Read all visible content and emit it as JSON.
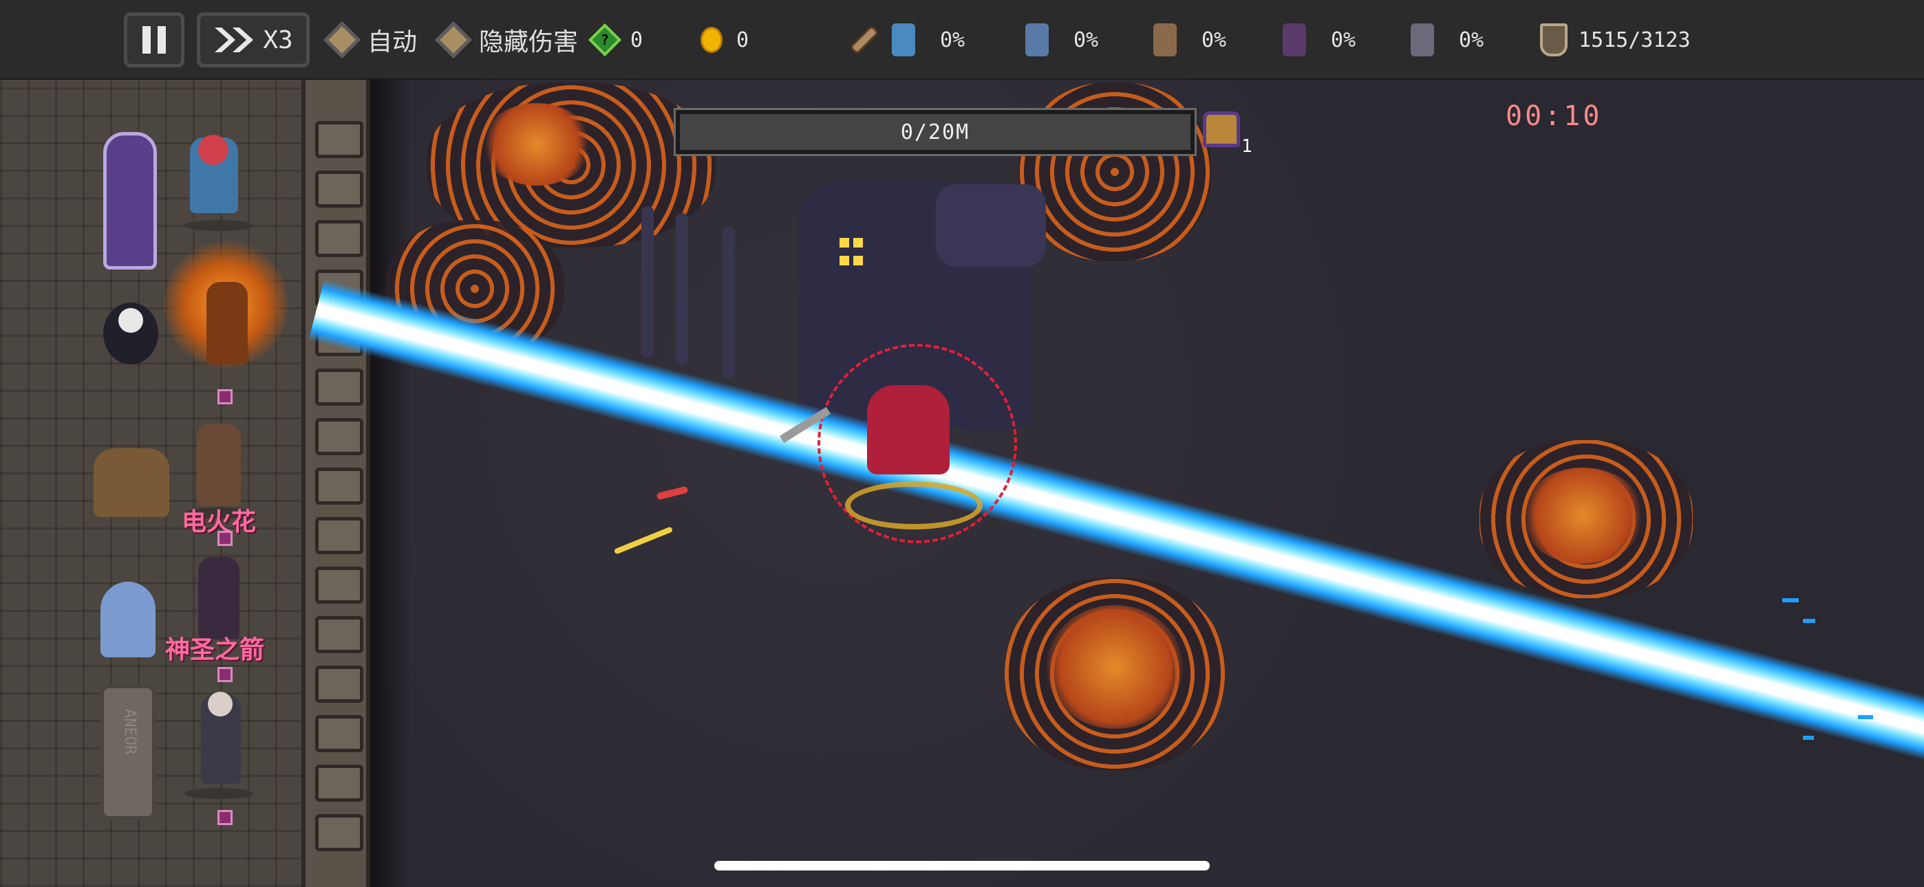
{
  "topbar": {
    "speed_label": "X3",
    "auto_label": "自动",
    "hide_damage_label": "隐藏伤害",
    "gems": "0",
    "gem_symbol": "?",
    "coins": "0",
    "hero_stats": [
      {
        "name": "dwarf-warrior",
        "pct": "0%",
        "color": "#4a8ac0"
      },
      {
        "name": "frost-spirit",
        "pct": "0%",
        "color": "#5a7aa8"
      },
      {
        "name": "barbarian",
        "pct": "0%",
        "color": "#8a6a4a"
      },
      {
        "name": "shadow-ninja",
        "pct": "0%",
        "color": "#5a3a6a"
      },
      {
        "name": "dark-swordsman",
        "pct": "0%",
        "color": "#6a6a7a"
      }
    ],
    "defense": "1515/3123"
  },
  "panel": {
    "hero_labels": [
      "电火花",
      "神圣之箭"
    ],
    "tombstone_text": "ANEOR"
  },
  "arena": {
    "wave_progress": "0/20M",
    "wave_fill": 0,
    "chest_count": "1",
    "timer": "00:10"
  },
  "colors": {
    "beam": "#1ea0ff",
    "lava": "#d8621a",
    "timer": "#ff8a8a"
  }
}
